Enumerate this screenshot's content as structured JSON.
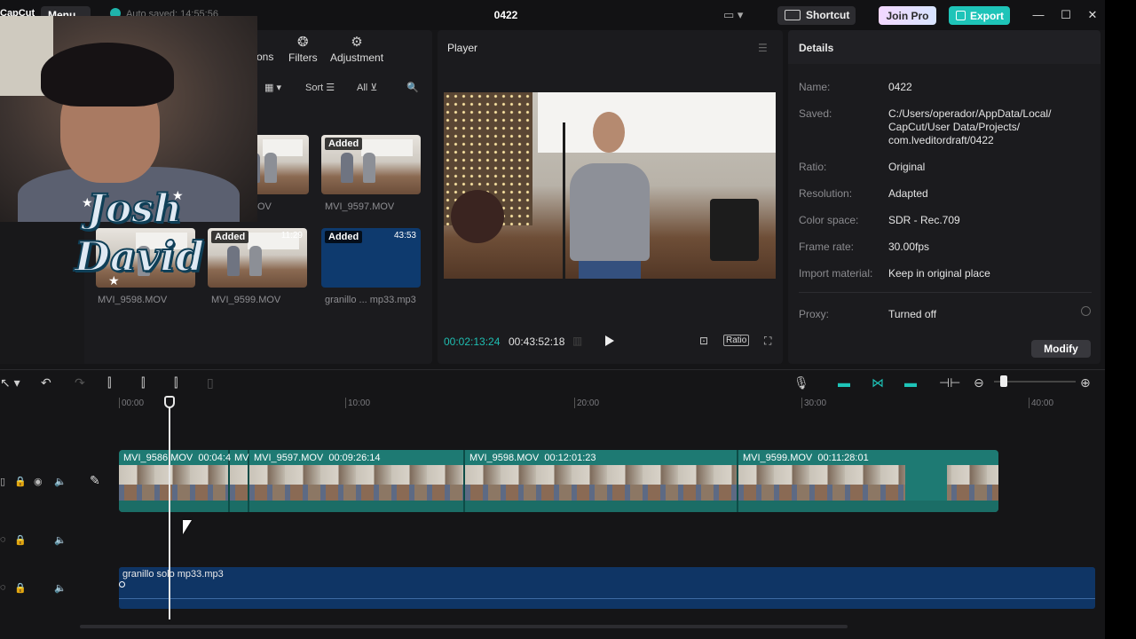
{
  "titlebar": {
    "logo": "CapCut",
    "menu_label": "Menu",
    "autosave_text": "Auto saved: 14:55:56",
    "project_title": "0422",
    "shortcut_label": "Shortcut",
    "joinpro_label": "Join Pro",
    "export_label": "Export",
    "controls": {
      "minimize": "—",
      "maximize": "☐",
      "close": "✕"
    }
  },
  "media": {
    "tabs": [
      {
        "label": "ons",
        "icon": "captions-icon"
      },
      {
        "label": "Filters",
        "icon": "filters-icon"
      },
      {
        "label": "Adjustment",
        "icon": "adjustment-icon"
      }
    ],
    "toolbar": {
      "sort_label": "Sort",
      "all_label": "All"
    },
    "items": [
      {
        "name": "",
        "badge": "",
        "duration": ""
      },
      {
        "name": "MVI_9597.MOV",
        "badge": "Added",
        "duration": ""
      },
      {
        "name": "MVI_9598.MOV",
        "badge": "",
        "duration": ""
      },
      {
        "name": "MVI_9599.MOV",
        "badge": "Added",
        "duration": "11:29"
      },
      {
        "name": "granillo ... mp33.mp3",
        "badge": "Added",
        "duration": "43:53"
      }
    ],
    "partial_label": "OV"
  },
  "overlay": {
    "logo_line1": "Josh",
    "logo_line2": "David"
  },
  "player": {
    "title": "Player",
    "current_time": "00:02:13:24",
    "total_time": "00:43:52:18",
    "ratio_label": "Ratio"
  },
  "details": {
    "title": "Details",
    "rows": [
      {
        "label": "Name:",
        "value": "0422"
      },
      {
        "label": "Saved:",
        "value": "C:/Users/operador/AppData/Local/ CapCut/User Data/Projects/ com.lveditordraft/0422"
      },
      {
        "label": "Ratio:",
        "value": "Original"
      },
      {
        "label": "Resolution:",
        "value": "Adapted"
      },
      {
        "label": "Color space:",
        "value": "SDR - Rec.709"
      },
      {
        "label": "Frame rate:",
        "value": "30.00fps"
      },
      {
        "label": "Import material:",
        "value": "Keep in original place"
      },
      {
        "label": "Proxy:",
        "value": "Turned off"
      }
    ],
    "modify_label": "Modify"
  },
  "timeline": {
    "ruler": [
      "00:00",
      "10:00",
      "20:00",
      "30:00",
      "40:00"
    ],
    "clips": [
      {
        "name": "MVI_9586.MOV",
        "duration": "00:04:4"
      },
      {
        "name": "MV",
        "duration": ""
      },
      {
        "name": "MVI_9597.MOV",
        "duration": "00:09:26:14"
      },
      {
        "name": "MVI_9598.MOV",
        "duration": "00:12:01:23"
      },
      {
        "name": "MVI_9599.MOV",
        "duration": "00:11:28:01"
      }
    ],
    "audio_clip": "granillo solo mp33.mp3"
  },
  "colors": {
    "accent": "#1ec4b8",
    "video_track": "#1e7a73",
    "audio_track": "#0f3565"
  }
}
